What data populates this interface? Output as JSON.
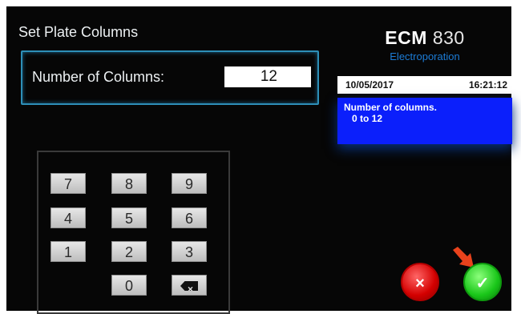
{
  "screen": {
    "title": "Set Plate Columns"
  },
  "field": {
    "label": "Number of Columns:",
    "value": "12"
  },
  "brand": {
    "name": "ECM",
    "model": "830",
    "subtitle": "Electroporation"
  },
  "status": {
    "date": "10/05/2017",
    "time": "16:21:12"
  },
  "help": {
    "line1": "Number of columns.",
    "line2": "0 to 12"
  },
  "keypad": {
    "keys": [
      "7",
      "8",
      "9",
      "4",
      "5",
      "6",
      "1",
      "2",
      "3",
      "0"
    ],
    "backspace_icon": "backspace-icon"
  },
  "actions": {
    "cancel_symbol": "×",
    "confirm_symbol": "✓"
  },
  "colors": {
    "accent": "#2d8fb8",
    "help_bg": "#0b1ffb",
    "cancel": "#d40000",
    "confirm": "#19c619",
    "arrow": "#e8421c"
  }
}
